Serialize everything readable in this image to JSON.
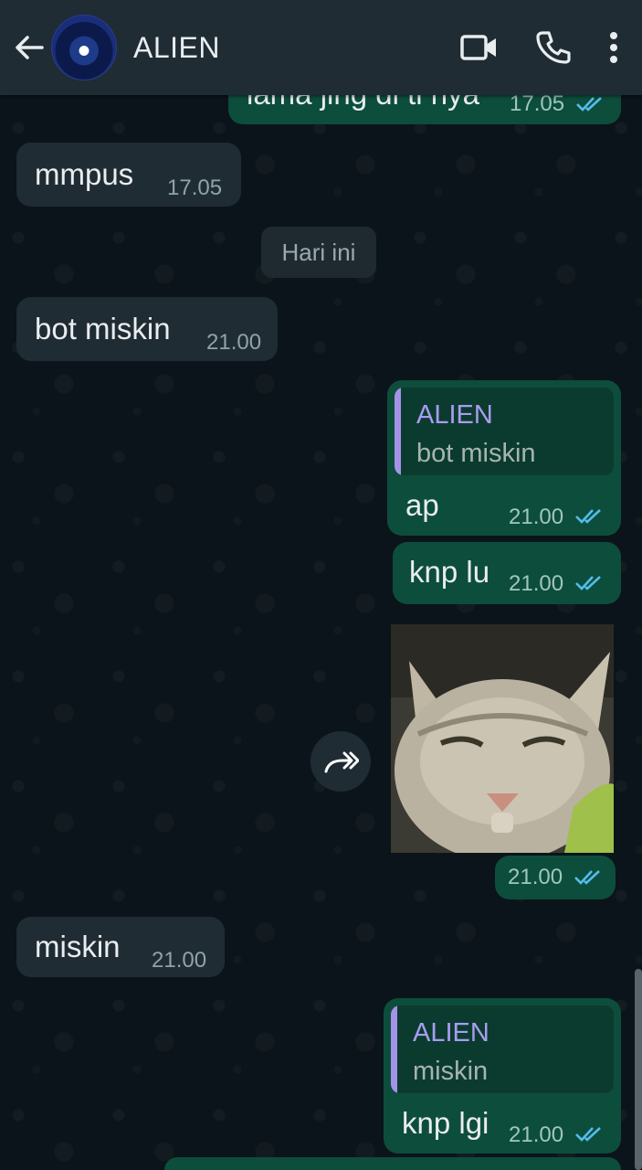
{
  "header": {
    "contact_name": "ALIEN",
    "icons": [
      "back-arrow-icon",
      "video-call-icon",
      "voice-call-icon",
      "menu-icon"
    ]
  },
  "messages": {
    "m0": {
      "text": "lama jing di ti nya",
      "time": "17.05"
    },
    "m1": {
      "text": "mmpus",
      "time": "17.05"
    },
    "date_divider": "Hari ini",
    "m2": {
      "text": "bot miskin",
      "time": "21.00"
    },
    "m3": {
      "quote_name": "ALIEN",
      "quote_text": "bot miskin",
      "text": "ap",
      "time": "21.00"
    },
    "m4": {
      "text": "knp lu",
      "time": "21.00"
    },
    "m5": {
      "image": "cat-photo",
      "time": "21.00"
    },
    "m6": {
      "text": "miskin",
      "time": "21.00"
    },
    "m7": {
      "quote_name": "ALIEN",
      "quote_text": "miskin",
      "text": "knp lgi",
      "time": "21.00"
    }
  },
  "colors": {
    "header": "#1f2c34",
    "background": "#0b141a",
    "incoming_bubble": "#202c33",
    "outgoing_bubble": "#0d4d3c",
    "read_ticks": "#53bdeb",
    "quote_accent": "#a593e8"
  }
}
